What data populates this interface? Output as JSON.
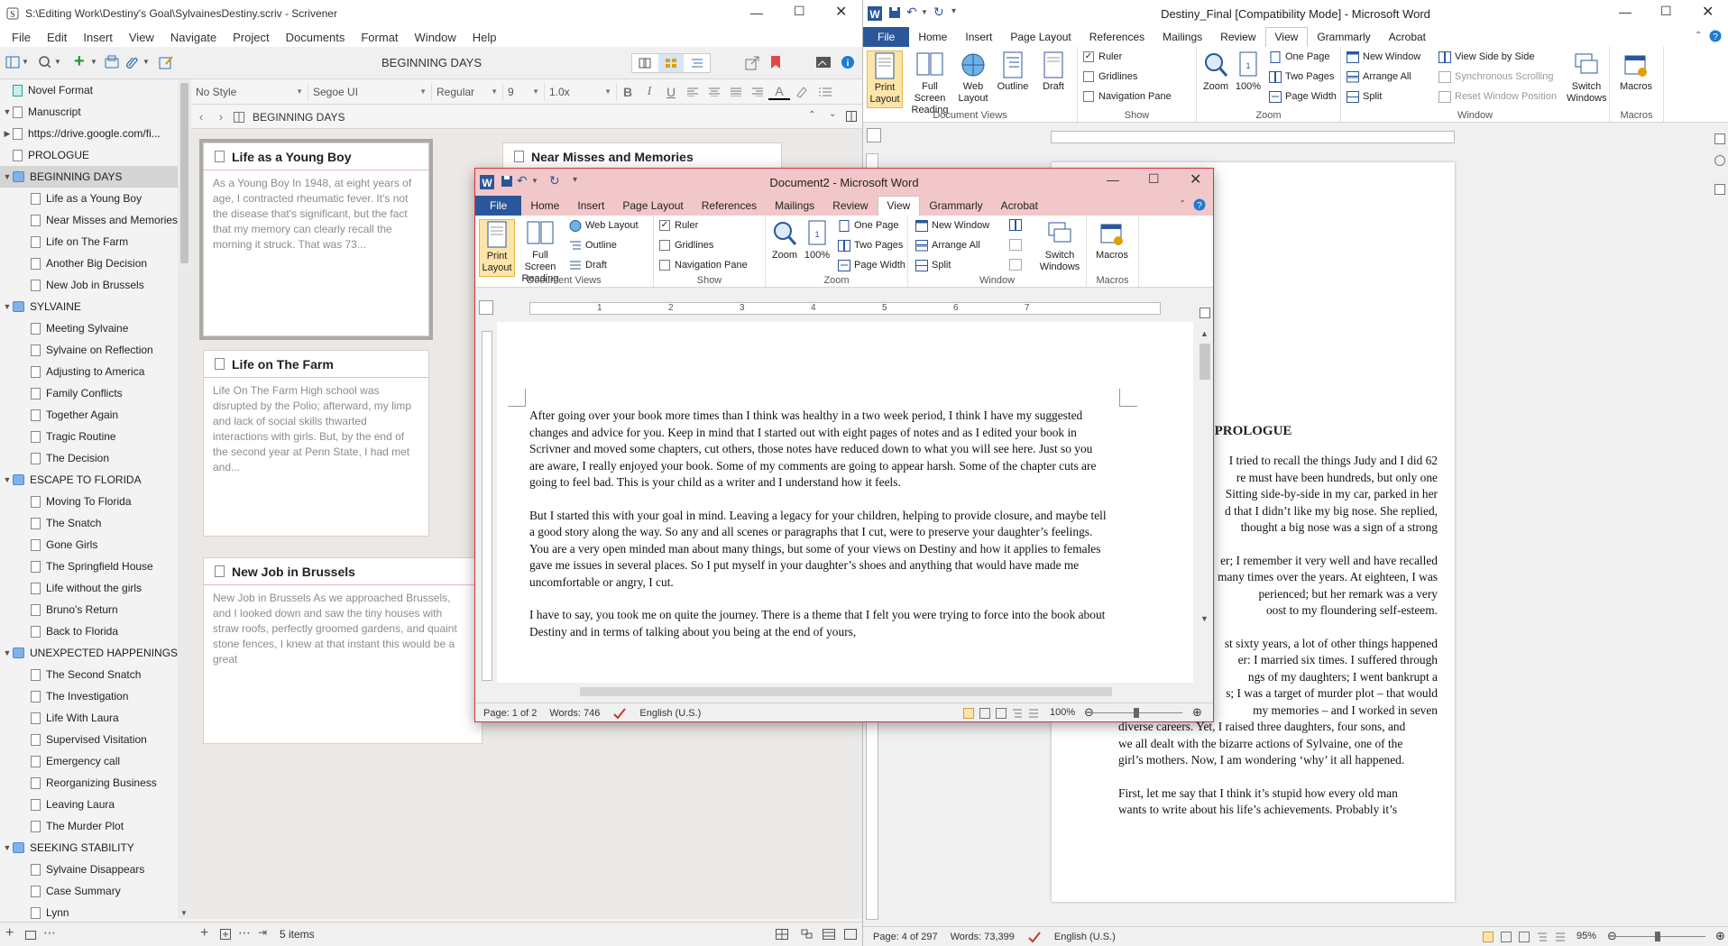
{
  "scrivener": {
    "title": "S:\\Editing Work\\Destiny's Goal\\SylvainesDestiny.scriv - Scrivener",
    "menu": [
      "File",
      "Edit",
      "Insert",
      "View",
      "Navigate",
      "Project",
      "Documents",
      "Format",
      "Window",
      "Help"
    ],
    "toolbar_title": "BEGINNING DAYS",
    "format": {
      "style": "No Style",
      "font": "Segoe UI",
      "weight": "Regular",
      "size": "9",
      "spacing": "1.0x"
    },
    "header_title": "BEGINNING DAYS",
    "binder": [
      {
        "label": "Novel Format",
        "kind": "special",
        "indent": 0,
        "caret": ""
      },
      {
        "label": "Manuscript",
        "kind": "doc",
        "indent": 0,
        "caret": "▼"
      },
      {
        "label": "https://drive.google.com/fi...",
        "kind": "doc",
        "indent": 1,
        "caret": "▶"
      },
      {
        "label": "PROLOGUE",
        "kind": "doc",
        "indent": 1,
        "caret": ""
      },
      {
        "label": "BEGINNING DAYS",
        "kind": "folder",
        "indent": 1,
        "caret": "▼",
        "selected": true
      },
      {
        "label": "Life as a Young Boy",
        "kind": "doc",
        "indent": 2,
        "caret": ""
      },
      {
        "label": "Near Misses and Memories",
        "kind": "doc",
        "indent": 2,
        "caret": ""
      },
      {
        "label": "Life on The Farm",
        "kind": "doc",
        "indent": 2,
        "caret": ""
      },
      {
        "label": "Another Big Decision",
        "kind": "doc",
        "indent": 2,
        "caret": ""
      },
      {
        "label": "New Job in Brussels",
        "kind": "doc",
        "indent": 2,
        "caret": ""
      },
      {
        "label": "SYLVAINE",
        "kind": "folder",
        "indent": 1,
        "caret": "▼"
      },
      {
        "label": "Meeting Sylvaine",
        "kind": "doc",
        "indent": 2,
        "caret": ""
      },
      {
        "label": "Sylvaine on Reflection",
        "kind": "doc",
        "indent": 2,
        "caret": ""
      },
      {
        "label": "Adjusting to America",
        "kind": "doc",
        "indent": 2,
        "caret": ""
      },
      {
        "label": "Family Conflicts",
        "kind": "doc",
        "indent": 2,
        "caret": ""
      },
      {
        "label": "Together Again",
        "kind": "doc",
        "indent": 2,
        "caret": ""
      },
      {
        "label": "Tragic Routine",
        "kind": "doc",
        "indent": 2,
        "caret": ""
      },
      {
        "label": "The Decision",
        "kind": "doc",
        "indent": 2,
        "caret": ""
      },
      {
        "label": "ESCAPE TO FLORIDA",
        "kind": "folder",
        "indent": 1,
        "caret": "▼"
      },
      {
        "label": "Moving To Florida",
        "kind": "doc",
        "indent": 2,
        "caret": ""
      },
      {
        "label": "The Snatch",
        "kind": "doc",
        "indent": 2,
        "caret": ""
      },
      {
        "label": "Gone Girls",
        "kind": "doc",
        "indent": 2,
        "caret": ""
      },
      {
        "label": "The Springfield House",
        "kind": "doc",
        "indent": 2,
        "caret": ""
      },
      {
        "label": "Life without the girls",
        "kind": "doc",
        "indent": 2,
        "caret": ""
      },
      {
        "label": "Bruno's Return",
        "kind": "doc",
        "indent": 2,
        "caret": ""
      },
      {
        "label": "Back to Florida",
        "kind": "doc",
        "indent": 2,
        "caret": ""
      },
      {
        "label": "UNEXPECTED HAPPENINGS",
        "kind": "folder",
        "indent": 1,
        "caret": "▼"
      },
      {
        "label": "The Second Snatch",
        "kind": "doc",
        "indent": 2,
        "caret": ""
      },
      {
        "label": "The Investigation",
        "kind": "doc",
        "indent": 2,
        "caret": ""
      },
      {
        "label": "Life With Laura",
        "kind": "doc",
        "indent": 2,
        "caret": ""
      },
      {
        "label": "Supervised Visitation",
        "kind": "doc",
        "indent": 2,
        "caret": ""
      },
      {
        "label": "Emergency call",
        "kind": "doc",
        "indent": 2,
        "caret": ""
      },
      {
        "label": "Reorganizing Business",
        "kind": "doc",
        "indent": 2,
        "caret": ""
      },
      {
        "label": "Leaving Laura",
        "kind": "doc",
        "indent": 2,
        "caret": ""
      },
      {
        "label": "The Murder Plot",
        "kind": "doc",
        "indent": 2,
        "caret": ""
      },
      {
        "label": "SEEKING STABILITY",
        "kind": "folder",
        "indent": 1,
        "caret": "▼"
      },
      {
        "label": "Sylvaine Disappears",
        "kind": "doc",
        "indent": 2,
        "caret": ""
      },
      {
        "label": "Case Summary",
        "kind": "doc",
        "indent": 2,
        "caret": ""
      },
      {
        "label": "Lynn",
        "kind": "doc",
        "indent": 2,
        "caret": ""
      }
    ],
    "cards": [
      {
        "title": "Life as a Young Boy",
        "synopsis": "As a Young Boy In 1948, at eight years of age, I contracted rheumatic fever. It's not the disease that's significant, but the fact that my memory can clearly recall the morning it struck. That was 73..."
      },
      {
        "title": "Near Misses and Memories",
        "synopsis": ""
      },
      {
        "title": "Life on The Farm",
        "synopsis": "Life On The Farm High school was disrupted by the Polio; afterward, my limp and lack of social skills thwarted interactions with girls. But, by the end of the second year at Penn State, I had met and..."
      },
      {
        "title": "New Job in Brussels",
        "synopsis": "New Job in Brussels As we approached Brussels, and I looked down and saw the tiny houses with straw roofs, perfectly groomed gardens, and quaint stone fences, I knew at that instant this would be a great"
      }
    ],
    "footer_items": "5 items"
  },
  "word_main": {
    "title": "Destiny_Final [Compatibility Mode] - Microsoft Word",
    "tabs": [
      "File",
      "Home",
      "Insert",
      "Page Layout",
      "References",
      "Mailings",
      "Review",
      "View",
      "Grammarly",
      "Acrobat"
    ],
    "active_tab": "View",
    "ribbon": {
      "print_layout": "Print Layout",
      "full_screen": "Full Screen Reading",
      "web_layout": "Web Layout",
      "outline": "Outline",
      "draft": "Draft",
      "group_views": "Document Views",
      "ruler": "Ruler",
      "gridlines": "Gridlines",
      "nav_pane": "Navigation Pane",
      "group_show": "Show",
      "zoom": "Zoom",
      "zoom100": "100%",
      "one_page": "One Page",
      "two_pages": "Two Pages",
      "page_width": "Page Width",
      "group_zoom": "Zoom",
      "new_window": "New Window",
      "arrange_all": "Arrange All",
      "split": "Split",
      "side_by_side": "View Side by Side",
      "sync_scroll": "Synchronous Scrolling",
      "reset_pos": "Reset Window Position",
      "switch_windows": "Switch Windows",
      "group_window": "Window",
      "macros": "Macros",
      "group_macros": "Macros"
    },
    "page": {
      "heading": "PROLOGUE",
      "para1": [
        "I tried to recall the things Judy and I did 62",
        "re must have been hundreds, but only one",
        "Sitting side-by-side in my car, parked in her",
        "d that I didn’t like my big nose. She replied,",
        "thought a big nose was a sign of a strong"
      ],
      "para2": [
        "er; I remember it very well and have recalled",
        "many times over the years. At eighteen, I was",
        "perienced; but her remark was a very",
        "oost to my floundering self-esteem."
      ],
      "para3": [
        "st sixty years, a lot of other things happened",
        "er: I married six times. I suffered through",
        "ngs of my daughters; I went bankrupt a",
        "s; I was a target of murder plot – that would",
        "my memories – and I worked in seven",
        "diverse careers. Yet, I raised three daughters, four sons, and",
        "we all dealt with the bizarre actions of Sylvaine, one of the",
        "girl’s mothers. Now, I am wondering ‘why’ it all happened."
      ],
      "para4": [
        "First, let me say that I think it’s stupid how every old man",
        "wants to write about his life’s achievements. Probably it’s"
      ]
    },
    "status": {
      "page": "Page: 4 of 297",
      "words": "Words: 73,399",
      "lang": "English (U.S.)",
      "zoom": "95%"
    }
  },
  "word_doc2": {
    "title": "Document2 - Microsoft Word",
    "tabs": [
      "File",
      "Home",
      "Insert",
      "Page Layout",
      "References",
      "Mailings",
      "Review",
      "View",
      "Grammarly",
      "Acrobat"
    ],
    "active_tab": "View",
    "ruler_numbers": [
      "1",
      "2",
      "3",
      "4",
      "5",
      "6",
      "7"
    ],
    "paragraphs": [
      "After going over your book more times than I think was healthy in a two week period, I think I have my suggested changes and advice for you. Keep in mind that I started out with eight pages of notes and as I edited your book in Scrivner and moved some chapters, cut others, those notes have reduced down to what you will see here. Just so you are aware, I really  enjoyed your book. Some of my comments are going to appear harsh.  Some of the chapter cuts are going to feel bad. This is your child as a writer and I understand how it feels.",
      "But I started this with your goal in mind. Leaving a legacy for your children, helping to provide closure, and maybe tell a good story along the way. So any and all scenes or paragraphs that I cut, were to preserve your daughter’s feelings. You are a very open minded man about many things, but some of your views on Destiny and how it applies to females gave me issues in several places. So I put myself in your daughter’s shoes and anything that would have made me uncomfortable or angry, I cut.",
      "I have to say, you took me on quite the journey. There is a theme that I felt you were trying to force into the book about Destiny and in terms of talking about you being at the end of yours,"
    ],
    "status": {
      "page": "Page: 1 of 2",
      "words": "Words: 746",
      "lang": "English (U.S.)",
      "zoom": "100%"
    }
  },
  "colors": {
    "word_blue": "#2b579a",
    "selected_button": "#fde5a9",
    "active_window_border": "#d8323a",
    "scriv_folder": "#7fb3e8"
  }
}
